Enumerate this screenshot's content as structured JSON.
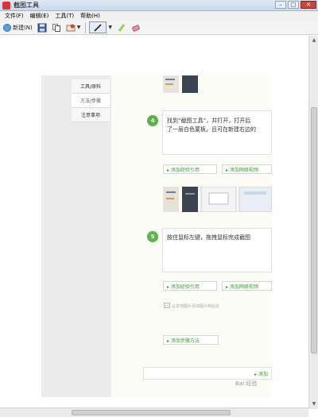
{
  "window": {
    "title": "截图工具"
  },
  "menu": [
    "文件(F)",
    "编辑(E)",
    "工具(T)",
    "帮助(H)"
  ],
  "toolbar": {
    "new_label": "新建(N)"
  },
  "sidebar": {
    "items": [
      {
        "label": "工具/原料"
      },
      {
        "label": "方法/步骤"
      },
      {
        "label": "注意事项"
      }
    ]
  },
  "steps": [
    {
      "number": "4",
      "text_line1": "找到“截图工具”，并打开，打开后",
      "text_line2": "了一层白色蒙板，且可在新建右边的"
    },
    {
      "number": "5",
      "text_line1": "按住鼠标左键，拖拽鼠标完成截图"
    }
  ],
  "actions": {
    "add_reference": "▸ 添加经验引用",
    "add_video": "▸ 添加网络视频",
    "add_step_method": "▸ 添加步骤方法",
    "add_bottom": "▸ 添加"
  },
  "hint": "从本地图片添加图片到此处",
  "watermark": "Bai 经验"
}
